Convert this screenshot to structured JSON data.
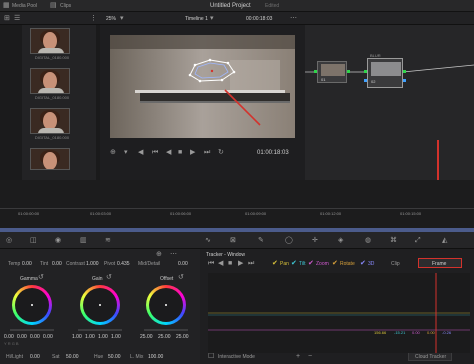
{
  "header": {
    "media_pool_label": "Media Pool",
    "clips_label": "Clips",
    "project_title": "Untitled Project",
    "project_status": "Edited"
  },
  "viewer_bar": {
    "zoom": "25%",
    "timeline_name": "Timeline 1",
    "timecode_top": "00:00:18:03"
  },
  "media_pool": {
    "clips": [
      {
        "caption": "DIGITAL_0180.000"
      },
      {
        "caption": "DIGITAL_0180.000"
      },
      {
        "caption": "DIGITAL_0180.000"
      },
      {
        "caption": ""
      }
    ]
  },
  "viewer": {
    "timecode": "01:00:18:03"
  },
  "nodes": {
    "node1_label": "01",
    "node2_title": "BLUR",
    "node2_label": "02"
  },
  "ruler": {
    "ticks": [
      "01:00:00:00",
      "01:00:03:00",
      "01:00:06:00",
      "01:00:09:00",
      "01:00:12:00",
      "01:00:15:00",
      "01:00:18:00",
      "01:00:21:00"
    ]
  },
  "primaries": {
    "temp_label": "Temp",
    "temp_value": "0.00",
    "tint_label": "Tint",
    "tint_value": "0.00",
    "contrast_label": "Contrast",
    "contrast_value": "1.000",
    "pivot_label": "Pivot",
    "pivot_value": "0.435",
    "middetail_label": "Mid/Detail",
    "middetail_value": "0.00",
    "wheels": [
      {
        "name": "Gamma",
        "values": [
          "0.00",
          "0.00",
          "0.00",
          "0.00"
        ]
      },
      {
        "name": "Gain",
        "values": [
          "1.00",
          "1.00",
          "1.00",
          "1.00"
        ]
      },
      {
        "name": "Offset",
        "values": [
          "25.00",
          "25.00",
          "25.00"
        ]
      }
    ],
    "hilight_label": "Hi/Light",
    "hilight_value": "0.00",
    "sat_label": "Sat",
    "sat_value": "50.00",
    "hue_label": "Hue",
    "hue_value": "50.00",
    "lum_label": "L. Mix",
    "lum_value": "100.00"
  },
  "tracker": {
    "title": "Tracker - Window",
    "pan": "Pan",
    "tilt": "Tilt",
    "zoom": "Zoom",
    "rotate": "Rotate",
    "threed": "3D",
    "clip": "Clip",
    "frame": "Frame",
    "ruler_ticks": [
      "00:00:00:00",
      "00:00:03:00",
      "00:00:06:00",
      "00:00:09:00",
      "00:00:12:00",
      "00:00:15:00"
    ],
    "readouts": [
      "156.66",
      "-15.21",
      "0.00",
      "0.00",
      "-0.26"
    ],
    "interactive_mode": "Interactive Mode",
    "cloud_tracker": "Cloud Tracker"
  },
  "colors": {
    "accent_red": "#d3322c",
    "tracker_yellow": "#d8c13a",
    "tracker_cyan": "#3fc8d6",
    "tracker_magenta": "#d05ad0"
  }
}
